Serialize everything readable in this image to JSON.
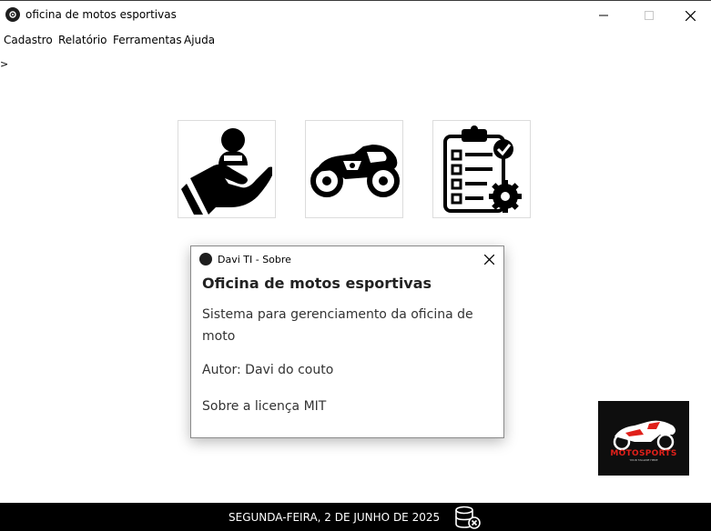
{
  "window": {
    "title": "oficina de motos esportivas",
    "icon": "app-gear-icon"
  },
  "menu": [
    "Cadastro",
    "Relatório",
    "Ferramentas",
    "Ajuda"
  ],
  "prompt": ">",
  "tiles": [
    {
      "icon": "client-hand-icon"
    },
    {
      "icon": "sport-motorcycle-icon"
    },
    {
      "icon": "service-checklist-icon"
    }
  ],
  "about": {
    "title": "Davi TI - Sobre",
    "heading": "Oficina de motos esportivas",
    "description": "Sistema para gerenciamento da oficina de moto",
    "author": "Autor: Davi do couto",
    "license": "Sobre a licença MIT"
  },
  "logo": {
    "brand": "MOTOSPORTS",
    "tagline": "YOUR TAGLINE HERE"
  },
  "status": {
    "date": "SEGUNDA-FEIRA, 2 DE JUNHO DE 2025",
    "db_icon": "database-disconnected-icon"
  },
  "colors": {
    "status_bg": "#000000",
    "logo_red": "#e0201a"
  }
}
